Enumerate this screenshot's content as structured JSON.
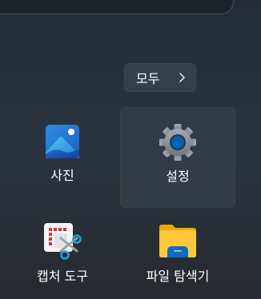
{
  "all_apps_button": {
    "label": "모두",
    "icon": "chevron-right-icon"
  },
  "apps": [
    {
      "label": "사진",
      "icon": "photos-icon",
      "selected": false
    },
    {
      "label": "설정",
      "icon": "settings-gear-icon",
      "selected": true
    },
    {
      "label": "캡처 도구",
      "icon": "snipping-tool-icon",
      "selected": false
    },
    {
      "label": "파일 탐색기",
      "icon": "file-explorer-icon",
      "selected": false
    }
  ],
  "colors": {
    "accent": "#0063b1",
    "tile_selected": "#323b46",
    "folder_yellow": "#ffc83d"
  }
}
